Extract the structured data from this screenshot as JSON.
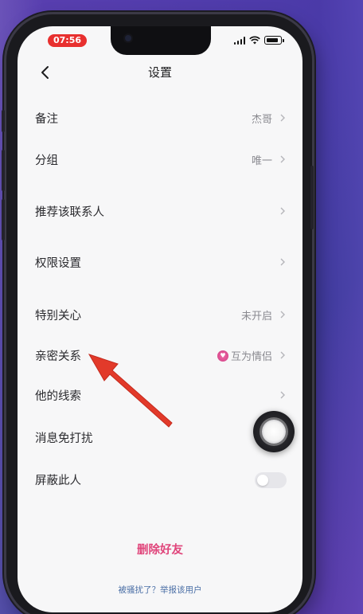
{
  "status_bar": {
    "time": "07:56"
  },
  "nav": {
    "title": "设置",
    "back_icon": "chevron-left-icon"
  },
  "settings": {
    "remark": {
      "label": "备注",
      "value": "杰哥"
    },
    "group": {
      "label": "分组",
      "value": "唯一"
    },
    "recommend": {
      "label": "推荐该联系人",
      "value": ""
    },
    "permissions": {
      "label": "权限设置",
      "value": ""
    },
    "special_care": {
      "label": "特别关心",
      "value": "未开启"
    },
    "intimate": {
      "label": "亲密关系",
      "value": "互为情侣",
      "icon": "heart-badge-icon"
    },
    "clues": {
      "label": "他的线索",
      "value": ""
    },
    "dnd": {
      "label": "消息免打扰"
    },
    "block": {
      "label": "屏蔽此人"
    }
  },
  "toggles": {
    "dnd_on": false,
    "block_on": false
  },
  "actions": {
    "delete_label": "删除好友"
  },
  "footer": {
    "report_label": "被骚扰了？举报该用户"
  },
  "colors": {
    "accent_delete": "#e0457b",
    "link": "#4b6fa6",
    "annotation_arrow": "#e23a2a"
  }
}
